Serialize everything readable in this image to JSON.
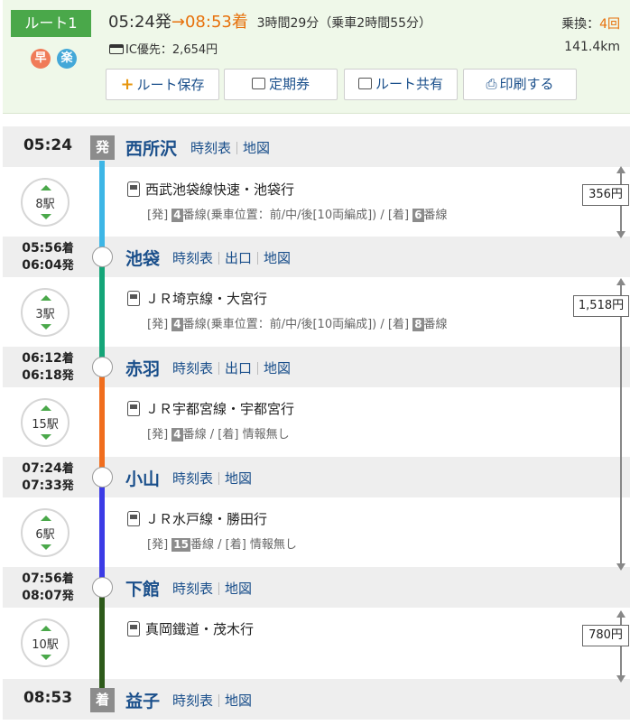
{
  "summary": {
    "route_label": "ルート1",
    "tags": [
      "早",
      "楽"
    ],
    "depart": "05:24発",
    "arrow": "→",
    "arrive": "08:53着",
    "duration": "3時間29分（乗車2時間55分）",
    "ic_fare": "IC優先：2,654円",
    "transfer_label": "乗換：",
    "transfer_count": "4回",
    "distance": "141.4km",
    "buttons": {
      "save": "ルート保存",
      "pass": "定期券",
      "share": "ルート共有",
      "print": "印刷する"
    }
  },
  "links": {
    "timetable": "時刻表",
    "exit": "出口",
    "map": "地図"
  },
  "stations": [
    {
      "time": "05:24",
      "mark": "発",
      "name": "西所沢"
    },
    {
      "arr": "05:56",
      "arr_suf": "着",
      "dep": "06:04",
      "dep_suf": "発",
      "name": "池袋"
    },
    {
      "arr": "06:12",
      "arr_suf": "着",
      "dep": "06:18",
      "dep_suf": "発",
      "name": "赤羽"
    },
    {
      "arr": "07:24",
      "arr_suf": "着",
      "dep": "07:33",
      "dep_suf": "発",
      "name": "小山"
    },
    {
      "arr": "07:56",
      "arr_suf": "着",
      "dep": "08:07",
      "dep_suf": "発",
      "name": "下館"
    },
    {
      "time": "08:53",
      "mark": "着",
      "name": "益子"
    }
  ],
  "legs": [
    {
      "stops": "8駅",
      "line": "西武池袋線快速・池袋行",
      "plat_pre": "[発]",
      "dep_plat": "4",
      "plat_mid": "番線(乗車位置：前/中/後[10両編成]) / [着]",
      "arr_plat": "6",
      "plat_post": "番線",
      "color": "#3db6e6"
    },
    {
      "stops": "3駅",
      "line": "ＪＲ埼京線・大宮行",
      "plat_pre": "[発]",
      "dep_plat": "4",
      "plat_mid": "番線(乗車位置：前/中/後[10両編成]) / [着]",
      "arr_plat": "8",
      "plat_post": "番線",
      "color": "#14a578"
    },
    {
      "stops": "15駅",
      "line": "ＪＲ宇都宮線・宇都宮行",
      "plat_pre": "[発]",
      "dep_plat": "4",
      "plat_mid": "番線 / [着] 情報無し",
      "arr_plat": "",
      "plat_post": "",
      "color": "#f06d1d"
    },
    {
      "stops": "6駅",
      "line": "ＪＲ水戸線・勝田行",
      "plat_pre": "[発]",
      "dep_plat": "15",
      "plat_mid": "番線 / [着] 情報無し",
      "arr_plat": "",
      "plat_post": "",
      "color": "#3b3be6"
    },
    {
      "stops": "10駅",
      "line": "真岡鐵道・茂木行",
      "plat_pre": "",
      "dep_plat": "",
      "plat_mid": "",
      "arr_plat": "",
      "plat_post": "",
      "color": "#2d5a1a"
    }
  ],
  "fares": [
    "356円",
    "1,518円",
    "780円"
  ]
}
